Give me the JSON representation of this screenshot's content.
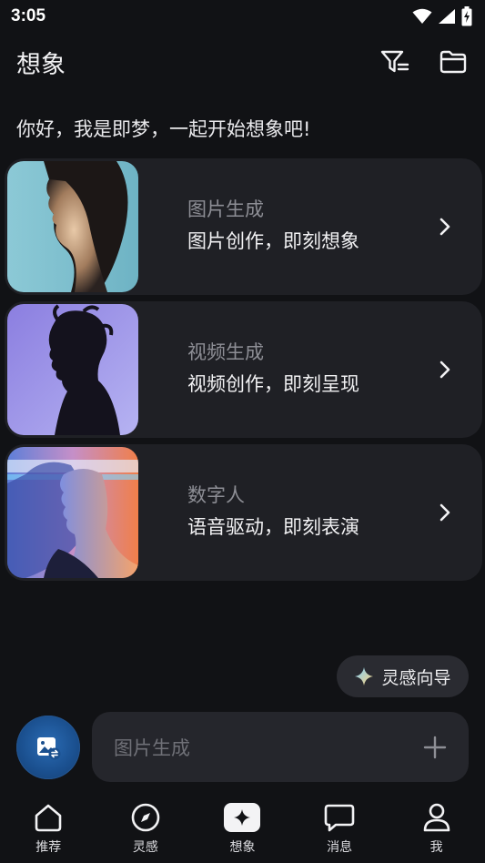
{
  "status": {
    "time": "3:05"
  },
  "header": {
    "title": "想象"
  },
  "greeting": "你好，我是即梦，一起开始想象吧!",
  "cards": [
    {
      "title": "图片生成",
      "subtitle": "图片创作，即刻想象"
    },
    {
      "title": "视频生成",
      "subtitle": "视频创作，即刻呈现"
    },
    {
      "title": "数字人",
      "subtitle": "语音驱动，即刻表演"
    }
  ],
  "guide": {
    "label": "灵感向导"
  },
  "prompt": {
    "placeholder": "图片生成"
  },
  "nav": [
    {
      "label": "推荐",
      "icon": "home-icon"
    },
    {
      "label": "灵感",
      "icon": "compass-icon"
    },
    {
      "label": "想象",
      "icon": "sparkle-icon",
      "active": true
    },
    {
      "label": "消息",
      "icon": "chat-icon"
    },
    {
      "label": "我",
      "icon": "person-icon"
    }
  ],
  "colors": {
    "background": "#111215",
    "card": "#1f2025",
    "accent": "#1a4f8e"
  }
}
